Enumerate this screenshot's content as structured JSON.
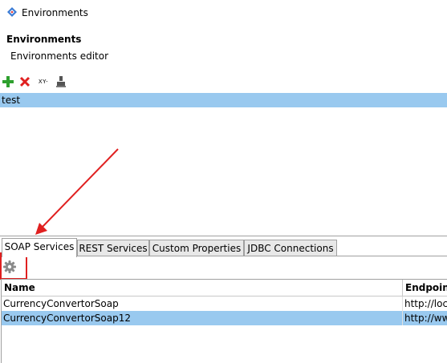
{
  "window": {
    "title": "Environments"
  },
  "header": {
    "title": "Environments",
    "subtitle": "Environments editor"
  },
  "toolbar": {
    "buttons": [
      {
        "icon": "add-icon"
      },
      {
        "icon": "delete-icon"
      },
      {
        "icon": "variables-icon",
        "label": "XY-"
      },
      {
        "icon": "user-icon"
      }
    ]
  },
  "environments": {
    "items": [
      {
        "label": "test",
        "selected": true
      }
    ]
  },
  "tabs": [
    {
      "label": "SOAP Services",
      "active": true
    },
    {
      "label": "REST Services",
      "active": false
    },
    {
      "label": "Custom Properties",
      "active": false
    },
    {
      "label": "JDBC Connections",
      "active": false
    }
  ],
  "services_table": {
    "columns": [
      "Name",
      "Endpoint"
    ],
    "rows": [
      {
        "name": "CurrencyConvertorSoap",
        "endpoint": "http://loca",
        "selected": false
      },
      {
        "name": "CurrencyConvertorSoap12",
        "endpoint": "http://ww",
        "selected": true
      }
    ]
  },
  "colors": {
    "selection": "#99c9ef",
    "add_green": "#2ea02e",
    "delete_red": "#e02020",
    "annotation_red": "#e02020"
  }
}
